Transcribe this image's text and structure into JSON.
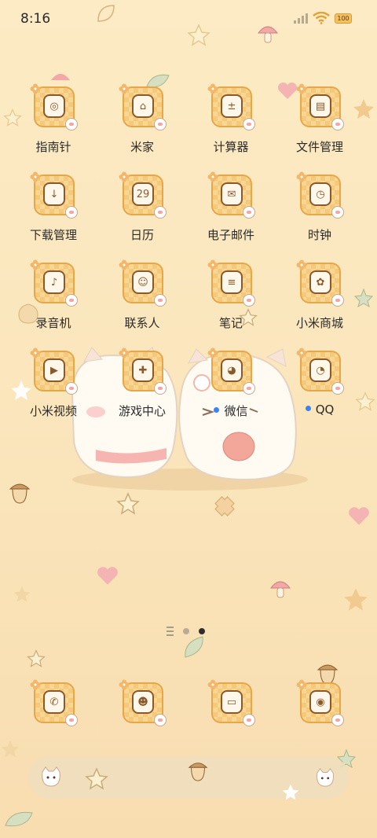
{
  "status_bar": {
    "time": "8:16",
    "battery": "100"
  },
  "home_apps": [
    {
      "label": "指南针",
      "icon": "compass-icon",
      "glyph": "◎"
    },
    {
      "label": "米家",
      "icon": "mijia-icon",
      "glyph": "⌂"
    },
    {
      "label": "计算器",
      "icon": "calculator-icon",
      "glyph": "±"
    },
    {
      "label": "文件管理",
      "icon": "file-manager-icon",
      "glyph": "▤"
    },
    {
      "label": "下载管理",
      "icon": "download-manager-icon",
      "glyph": "↓"
    },
    {
      "label": "日历",
      "icon": "calendar-icon",
      "glyph": "29"
    },
    {
      "label": "电子邮件",
      "icon": "email-icon",
      "glyph": "✉"
    },
    {
      "label": "时钟",
      "icon": "clock-icon",
      "glyph": "◷"
    },
    {
      "label": "录音机",
      "icon": "recorder-icon",
      "glyph": "♪"
    },
    {
      "label": "联系人",
      "icon": "contacts-icon",
      "glyph": "☺"
    },
    {
      "label": "笔记",
      "icon": "notes-icon",
      "glyph": "≡"
    },
    {
      "label": "小米商城",
      "icon": "mi-store-icon",
      "glyph": "✿"
    },
    {
      "label": "小米视频",
      "icon": "mi-video-icon",
      "glyph": "▶"
    },
    {
      "label": "游戏中心",
      "icon": "game-center-icon",
      "glyph": "✚"
    },
    {
      "label": "微信",
      "icon": "wechat-icon",
      "glyph": "◕"
    },
    {
      "label": "QQ",
      "icon": "qq-icon",
      "glyph": "◔"
    }
  ],
  "dock_apps": [
    {
      "icon": "phone-icon",
      "glyph": "✆"
    },
    {
      "icon": "messages-icon",
      "glyph": "☻"
    },
    {
      "icon": "browser-icon",
      "glyph": "▭"
    },
    {
      "icon": "camera-icon",
      "glyph": "◉"
    }
  ],
  "colors": {
    "icon_border": "#e7a648",
    "notification_dot": "#3b82f6"
  }
}
